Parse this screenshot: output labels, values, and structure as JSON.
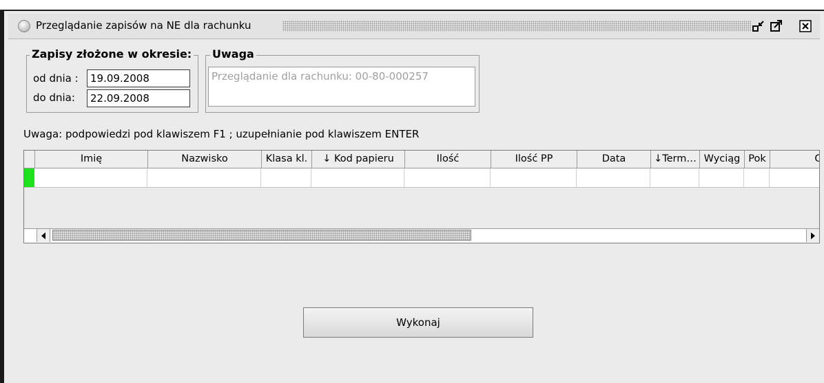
{
  "window": {
    "title": "Przeglądanie zapisów na NE dla rachunku",
    "buttons": [
      "minimize-icon",
      "maximize-icon",
      "close-icon"
    ]
  },
  "period": {
    "legend": "Zapisy złożone w okresie:",
    "from_label": "od dnia :",
    "from_value": "19.09.2008",
    "to_label": "do dnia:",
    "to_value": "22.09.2008"
  },
  "note": {
    "legend": "Uwaga",
    "text": "Przeglądanie dla rachunku: 00-80-000257"
  },
  "hint": "Uwaga: podpowiedzi pod klawiszem F1 ; uzupełnianie pod klawiszem ENTER",
  "grid": {
    "columns": [
      "Imię",
      "Nazwisko",
      "Klasa kl.",
      "↓ Kod papieru",
      "Ilość",
      "Ilość PP",
      "Data",
      "↓Term…",
      "Wyciąg",
      "Pok",
      "Op"
    ],
    "selected_row_color": "#1fe01f"
  },
  "actions": {
    "execute_label": "Wykonaj"
  }
}
